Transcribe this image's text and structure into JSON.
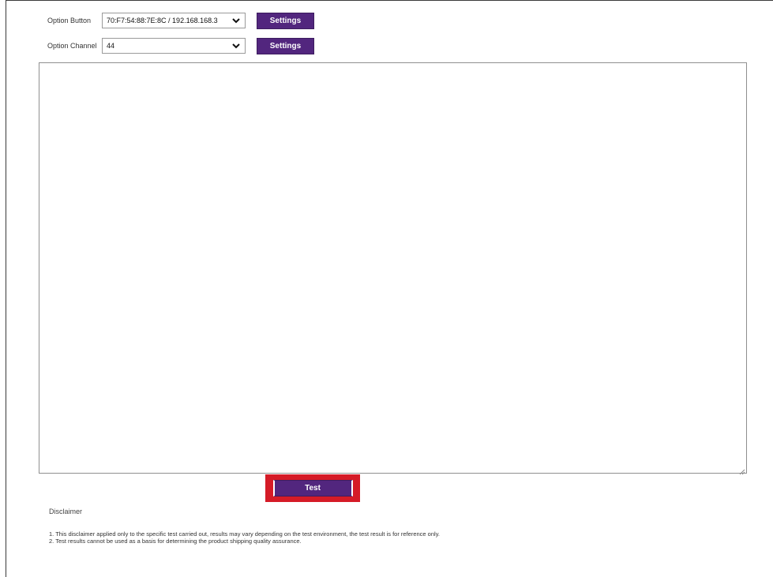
{
  "options": {
    "button": {
      "label": "Option Button",
      "selected_value": "70:F7:54:88:7E:8C / 192.168.168.3",
      "settings_label": "Settings"
    },
    "channel": {
      "label": "Option Channel",
      "selected_value": "44",
      "settings_label": "Settings"
    }
  },
  "output_area": {
    "value": ""
  },
  "actions": {
    "test_label": "Test"
  },
  "disclaimer": {
    "title": "Disclaimer",
    "lines": [
      "1. This disclaimer applied only to the specific test carried out, results may vary depending on the test environment, the test result is for reference only.",
      "2. Test results cannot be used as a basis for determining the product shipping quality assurance."
    ]
  },
  "colors": {
    "button_bg": "#52267e",
    "highlight": "#d51b27"
  },
  "icons": {
    "select_arrow": "chevron-down-icon",
    "resize": "resize-handle-icon"
  }
}
